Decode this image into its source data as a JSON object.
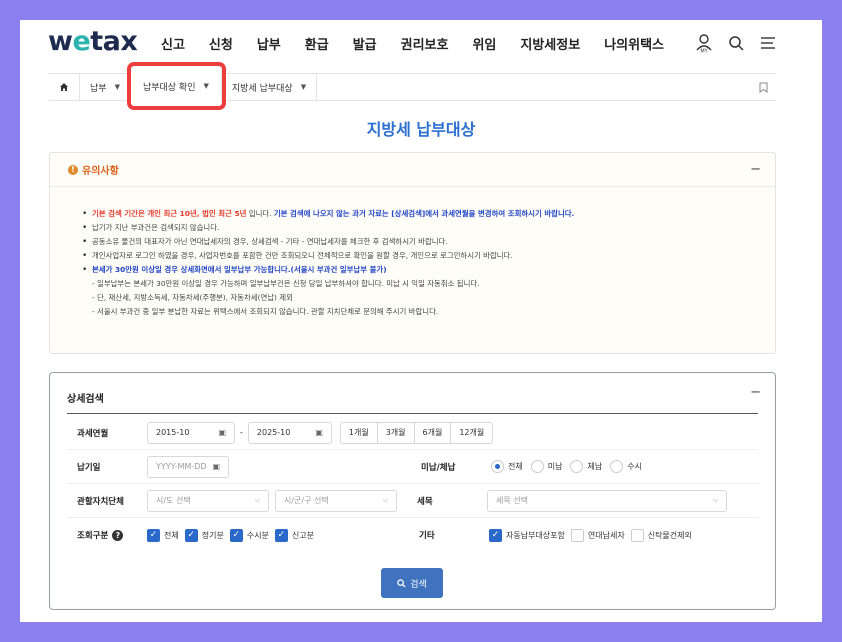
{
  "header": {
    "logo_main": "w",
    "logo_e": "e",
    "logo_rest": "tax",
    "menu": [
      "신고",
      "신청",
      "납부",
      "환급",
      "발급",
      "권리보호",
      "위임",
      "지방세정보",
      "나의위택스"
    ],
    "icons": [
      "my-user-icon",
      "search-icon",
      "menu-icon"
    ]
  },
  "breadcrumb": {
    "home_icon": "home-icon",
    "items": [
      "납부",
      "납부대상 확인",
      "지방세 납부대상"
    ],
    "bookmark_icon": "bookmark-icon"
  },
  "page_title": "지방세 납부대상",
  "notice": {
    "title": "유의사항",
    "toggle": "−",
    "line1_red": "기본 검색 기간은 개인 최근 10년, 법인 최근 5년",
    "line1_mid": " 입니다. ",
    "line1_blue": "기본 검색에 나오지 않는 과거 자료는 [상세검색]에서 과세연월을 변경하여 조회하시기 바랍니다.",
    "line2": "납기가 지난 부과건은 검색되지 않습니다.",
    "line3": "공동소유 물건의 대표자가 아닌 연대납세자의 경우, 상세검색 - 기타 - 연대납세자를 체크한 후 검색하시기 바랍니다.",
    "line4": "개인사업자로 로그인 하였을 경우, 사업자번호를 포함한 건만 조회되오니 전체적으로 확인을 원할 경우, 개인으로 로그인하시기 바랍니다.",
    "line5_blue": "본세가 30만원 이상일 경우 상세화면에서 일부납부 가능합니다.(서울시 부과건 일부납부 불가)",
    "sub1": "- 일부납부는 본세가 30만원 이상일 경우 가능하며 일부납부건은 신청 당일 납부하셔야 합니다. 미납 시 익일 자동취소 됩니다.",
    "sub2": "- 단, 재산세, 지방소득세, 자동차세(주행분), 자동차세(연납) 제외",
    "sub3": "- 서울시 부과건 중 일부 분납한 자료는 위택스에서 조회되지 않습니다. 관할 지치단체로 문의해 주시기 바랍니다."
  },
  "search": {
    "title": "상세검색",
    "toggle": "−",
    "period_label": "과세연월",
    "period_from": "2015-10",
    "period_sep": "-",
    "period_to": "2025-10",
    "period_chips": [
      "1개월",
      "3개월",
      "6개월",
      "12개월"
    ],
    "due_label": "납기일",
    "due_placeholder": "YYYY-MM-DD",
    "status_label": "미납/체납",
    "status_options": [
      "전체",
      "미납",
      "체납",
      "수시"
    ],
    "status_selected": "전체",
    "region_label": "관할자치단체",
    "sido_placeholder": "시/도 선택",
    "sigungu_placeholder": "시/군/구 선택",
    "tax_label": "세목",
    "tax_placeholder": "세목 선택",
    "type_label": "조회구분",
    "type_help": "?",
    "type_options": [
      "전체",
      "정기분",
      "수시분",
      "신고분"
    ],
    "etc_label": "기타",
    "etc_options": [
      {
        "label": "자동납부대상포함",
        "checked": true
      },
      {
        "label": "연대납세자",
        "checked": false
      },
      {
        "label": "신탁물건제외",
        "checked": false
      }
    ],
    "button": "검색"
  },
  "colors": {
    "accent": "#2c6fd1",
    "highlight": "#ee3d3d",
    "button": "#3f73bf",
    "background": "#8c7ff0"
  }
}
